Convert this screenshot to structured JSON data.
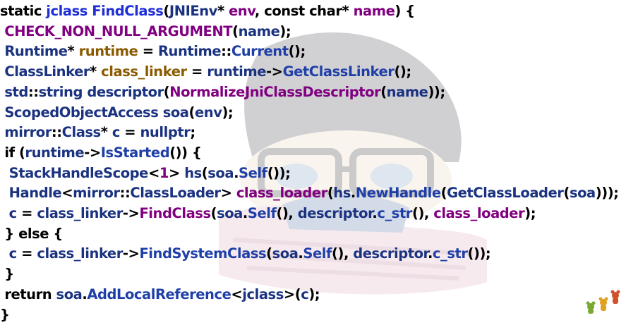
{
  "code_lines": [
    [
      {
        "t": "static ",
        "c": "c-kw"
      },
      {
        "t": "jclass ",
        "c": "c-fn"
      },
      {
        "t": "FindClass",
        "c": "c-fn"
      },
      {
        "t": "(",
        "c": "c-punc"
      },
      {
        "t": "JNIEnv",
        "c": "c-type"
      },
      {
        "t": "* ",
        "c": "c-punc"
      },
      {
        "t": "env",
        "c": "c-call"
      },
      {
        "t": ", ",
        "c": "c-punc"
      },
      {
        "t": "const char",
        "c": "c-kw"
      },
      {
        "t": "* ",
        "c": "c-punc"
      },
      {
        "t": "name",
        "c": "c-call"
      },
      {
        "t": ") {",
        "c": "c-punc"
      }
    ],
    [
      {
        "t": " CHECK_NON_NULL_ARGUMENT",
        "c": "c-macro"
      },
      {
        "t": "(",
        "c": "c-punc"
      },
      {
        "t": "name",
        "c": "c-plain"
      },
      {
        "t": ");",
        "c": "c-punc"
      }
    ],
    [
      {
        "t": " Runtime",
        "c": "c-type"
      },
      {
        "t": "* ",
        "c": "c-punc"
      },
      {
        "t": "runtime",
        "c": "c-var"
      },
      {
        "t": " = ",
        "c": "c-punc"
      },
      {
        "t": "Runtime",
        "c": "c-type"
      },
      {
        "t": "::",
        "c": "c-punc"
      },
      {
        "t": "Current",
        "c": "c-method"
      },
      {
        "t": "();",
        "c": "c-punc"
      }
    ],
    [
      {
        "t": " ClassLinker",
        "c": "c-type"
      },
      {
        "t": "* ",
        "c": "c-punc"
      },
      {
        "t": "class_linker",
        "c": "c-var"
      },
      {
        "t": " = ",
        "c": "c-punc"
      },
      {
        "t": "runtime",
        "c": "c-plain"
      },
      {
        "t": "->",
        "c": "c-punc"
      },
      {
        "t": "GetClassLinker",
        "c": "c-method"
      },
      {
        "t": "();",
        "c": "c-punc"
      }
    ],
    [
      {
        "t": " std",
        "c": "c-type"
      },
      {
        "t": "::",
        "c": "c-punc"
      },
      {
        "t": "string ",
        "c": "c-type"
      },
      {
        "t": "descriptor",
        "c": "c-plain"
      },
      {
        "t": "(",
        "c": "c-punc"
      },
      {
        "t": "NormalizeJniClassDescriptor",
        "c": "c-call"
      },
      {
        "t": "(",
        "c": "c-punc"
      },
      {
        "t": "name",
        "c": "c-plain"
      },
      {
        "t": "));",
        "c": "c-punc"
      }
    ],
    [
      {
        "t": " ScopedObjectAccess ",
        "c": "c-type"
      },
      {
        "t": "soa",
        "c": "c-plain"
      },
      {
        "t": "(",
        "c": "c-punc"
      },
      {
        "t": "env",
        "c": "c-plain"
      },
      {
        "t": ");",
        "c": "c-punc"
      }
    ],
    [
      {
        "t": " mirror",
        "c": "c-type"
      },
      {
        "t": "::",
        "c": "c-punc"
      },
      {
        "t": "Class",
        "c": "c-type"
      },
      {
        "t": "* ",
        "c": "c-punc"
      },
      {
        "t": "c",
        "c": "c-plain"
      },
      {
        "t": " = ",
        "c": "c-punc"
      },
      {
        "t": "nullptr",
        "c": "c-nullptr"
      },
      {
        "t": ";",
        "c": "c-punc"
      }
    ],
    [
      {
        "t": " if ",
        "c": "c-kw"
      },
      {
        "t": "(",
        "c": "c-punc"
      },
      {
        "t": "runtime",
        "c": "c-plain"
      },
      {
        "t": "->",
        "c": "c-punc"
      },
      {
        "t": "IsStarted",
        "c": "c-method"
      },
      {
        "t": "()) {",
        "c": "c-punc"
      }
    ],
    [
      {
        "t": "  StackHandleScope",
        "c": "c-type"
      },
      {
        "t": "<",
        "c": "c-punc"
      },
      {
        "t": "1",
        "c": "c-num"
      },
      {
        "t": "> ",
        "c": "c-punc"
      },
      {
        "t": "hs",
        "c": "c-plain"
      },
      {
        "t": "(",
        "c": "c-punc"
      },
      {
        "t": "soa",
        "c": "c-plain"
      },
      {
        "t": ".",
        "c": "c-punc"
      },
      {
        "t": "Self",
        "c": "c-method"
      },
      {
        "t": "());",
        "c": "c-punc"
      }
    ],
    [
      {
        "t": "  Handle",
        "c": "c-type"
      },
      {
        "t": "<",
        "c": "c-punc"
      },
      {
        "t": "mirror",
        "c": "c-type"
      },
      {
        "t": "::",
        "c": "c-punc"
      },
      {
        "t": "ClassLoader",
        "c": "c-type"
      },
      {
        "t": "> ",
        "c": "c-punc"
      },
      {
        "t": "class_loader",
        "c": "c-call"
      },
      {
        "t": "(",
        "c": "c-punc"
      },
      {
        "t": "hs",
        "c": "c-plain"
      },
      {
        "t": ".",
        "c": "c-punc"
      },
      {
        "t": "NewHandle",
        "c": "c-method"
      },
      {
        "t": "(",
        "c": "c-punc"
      },
      {
        "t": "GetClassLoader",
        "c": "c-plain"
      },
      {
        "t": "(",
        "c": "c-punc"
      },
      {
        "t": "soa",
        "c": "c-plain"
      },
      {
        "t": ")));",
        "c": "c-punc"
      }
    ],
    [
      {
        "t": "  c",
        "c": "c-plain"
      },
      {
        "t": " = ",
        "c": "c-punc"
      },
      {
        "t": "class_linker",
        "c": "c-plain"
      },
      {
        "t": "->",
        "c": "c-punc"
      },
      {
        "t": "FindClass",
        "c": "c-call"
      },
      {
        "t": "(",
        "c": "c-punc"
      },
      {
        "t": "soa",
        "c": "c-plain"
      },
      {
        "t": ".",
        "c": "c-punc"
      },
      {
        "t": "Self",
        "c": "c-method"
      },
      {
        "t": "(), ",
        "c": "c-punc"
      },
      {
        "t": "descriptor",
        "c": "c-plain"
      },
      {
        "t": ".",
        "c": "c-punc"
      },
      {
        "t": "c_str",
        "c": "c-method"
      },
      {
        "t": "(), ",
        "c": "c-punc"
      },
      {
        "t": "class_loader",
        "c": "c-call"
      },
      {
        "t": ");",
        "c": "c-punc"
      }
    ],
    [
      {
        "t": " } else {",
        "c": "c-kw"
      }
    ],
    [
      {
        "t": "  c",
        "c": "c-plain"
      },
      {
        "t": " = ",
        "c": "c-punc"
      },
      {
        "t": "class_linker",
        "c": "c-plain"
      },
      {
        "t": "->",
        "c": "c-punc"
      },
      {
        "t": "FindSystemClass",
        "c": "c-method"
      },
      {
        "t": "(",
        "c": "c-punc"
      },
      {
        "t": "soa",
        "c": "c-plain"
      },
      {
        "t": ".",
        "c": "c-punc"
      },
      {
        "t": "Self",
        "c": "c-method"
      },
      {
        "t": "(), ",
        "c": "c-punc"
      },
      {
        "t": "descriptor",
        "c": "c-plain"
      },
      {
        "t": ".",
        "c": "c-punc"
      },
      {
        "t": "c_str",
        "c": "c-method"
      },
      {
        "t": "());",
        "c": "c-punc"
      }
    ],
    [
      {
        "t": " }",
        "c": "c-punc"
      }
    ],
    [
      {
        "t": " return ",
        "c": "c-kw"
      },
      {
        "t": "soa",
        "c": "c-plain"
      },
      {
        "t": ".",
        "c": "c-punc"
      },
      {
        "t": "AddLocalReference",
        "c": "c-method"
      },
      {
        "t": "<",
        "c": "c-punc"
      },
      {
        "t": "jclass",
        "c": "c-plain"
      },
      {
        "t": ">(",
        "c": "c-punc"
      },
      {
        "t": "c",
        "c": "c-plain"
      },
      {
        "t": ");",
        "c": "c-punc"
      }
    ],
    [
      {
        "t": "}",
        "c": "c-punc"
      }
    ]
  ],
  "decorations": {
    "watermark_icon": "cartoon-character-illustration",
    "corner_icon": "bear-figures-icon"
  }
}
